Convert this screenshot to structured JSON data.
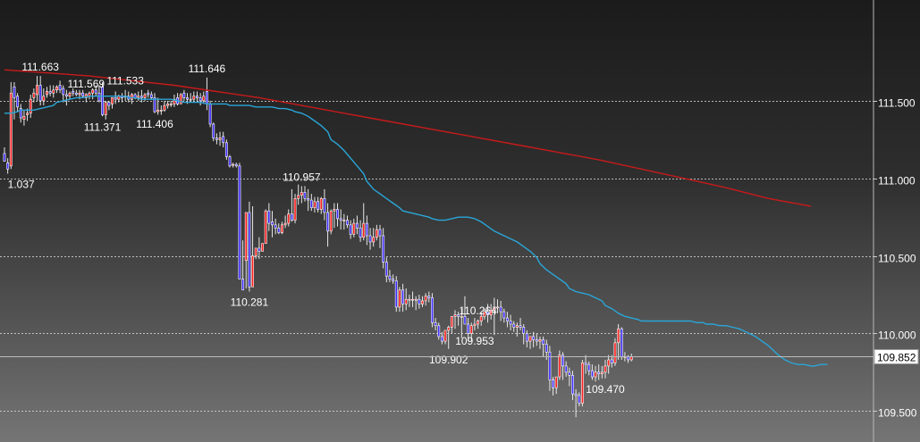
{
  "colors": {
    "up": "#ff1f1f",
    "down": "#3c2bff",
    "ma_short": "#2aa6d8",
    "ma_long": "#c81a1a",
    "grid": "#dddddd"
  },
  "chart_data": {
    "type": "candlestick",
    "ylim": [
      109.3,
      112.15
    ],
    "y_ticks": [
      {
        "value": 111.5,
        "label": "111.500"
      },
      {
        "value": 111.0,
        "label": "111.000"
      },
      {
        "value": 110.5,
        "label": "110.500"
      },
      {
        "value": 110.0,
        "label": "110.000"
      },
      {
        "value": 109.5,
        "label": "109.500"
      }
    ],
    "current_price": {
      "value": 109.852,
      "label": "109.852"
    },
    "x": [
      0,
      1,
      2,
      3,
      4,
      5,
      6,
      7,
      8,
      9,
      10,
      11,
      12,
      13,
      14,
      15,
      16,
      17,
      18,
      19,
      20,
      21,
      22,
      23,
      24,
      25,
      26,
      27,
      28,
      29,
      30,
      31,
      32,
      33,
      34,
      35,
      36,
      37,
      38,
      39,
      40,
      41,
      42,
      43,
      44,
      45,
      46,
      47,
      48,
      49,
      50,
      51,
      52,
      53,
      54,
      55,
      56,
      57,
      58,
      59,
      60,
      61,
      62,
      63,
      64,
      65,
      66,
      67,
      68,
      69,
      70,
      71,
      72,
      73,
      74,
      75,
      76,
      77,
      78,
      79,
      80,
      81,
      82,
      83,
      84,
      85,
      86,
      87,
      88,
      89,
      90,
      91,
      92,
      93,
      94,
      95,
      96,
      97,
      98,
      99,
      100,
      101,
      102,
      103,
      104,
      105,
      106,
      107,
      108,
      109,
      110,
      111,
      112,
      113,
      114,
      115,
      116,
      117,
      118,
      119,
      120,
      121,
      122,
      123,
      124,
      125,
      126,
      127,
      128,
      129,
      130,
      131,
      132,
      133,
      134,
      135,
      136,
      137,
      138,
      139,
      140,
      141,
      142,
      143,
      144,
      145,
      146,
      147,
      148,
      149,
      150,
      151,
      152,
      153,
      154,
      155,
      156,
      157,
      158,
      159,
      160,
      161,
      162,
      163,
      164,
      165,
      166,
      167,
      168,
      169,
      170,
      171,
      172,
      173,
      174,
      175,
      176,
      177,
      178,
      179,
      180,
      181,
      182,
      183,
      184,
      185,
      186,
      187,
      188,
      189,
      190,
      191,
      192,
      193,
      194,
      195,
      196,
      197,
      198,
      199,
      200,
      201,
      202,
      203,
      204,
      205,
      206,
      207,
      208,
      209,
      210,
      211,
      212,
      213,
      214,
      215,
      216,
      217,
      218,
      219,
      220,
      221,
      222,
      223,
      224,
      225,
      226,
      227,
      228,
      229,
      230,
      231,
      232,
      233,
      234,
      235,
      236,
      237,
      238,
      239,
      240,
      241,
      242,
      243,
      244,
      245,
      246,
      247,
      248,
      249,
      250,
      251,
      252
    ],
    "open": [
      111.16,
      111.1,
      111.08,
      111.59,
      111.53,
      111.45,
      111.38,
      111.41,
      111.42,
      111.52,
      111.54,
      111.6,
      111.5,
      111.54,
      111.56,
      111.55,
      111.57,
      111.6,
      111.58,
      111.54,
      111.53,
      111.56,
      111.55,
      111.54,
      111.55,
      111.52,
      111.53,
      111.55,
      111.57,
      111.55,
      111.59,
      111.41,
      111.49,
      111.48,
      111.52,
      111.51,
      111.53,
      111.53,
      111.53,
      111.51,
      111.54,
      111.52,
      111.53,
      111.52,
      111.55,
      111.54,
      111.52,
      111.43,
      111.44,
      111.44,
      111.47,
      111.48,
      111.48,
      111.52,
      111.48,
      111.55,
      111.52,
      111.51,
      111.51,
      111.53,
      111.52,
      111.5,
      111.56,
      111.48,
      111.35,
      111.26,
      111.25,
      111.27,
      111.23,
      111.14,
      111.09,
      111.09,
      111.08,
      110.35,
      110.47,
      110.78,
      110.3,
      110.5,
      110.55,
      110.53,
      110.58,
      110.79,
      110.72,
      110.7,
      110.68,
      110.65,
      110.7,
      110.71,
      110.77,
      110.73,
      110.87,
      110.89,
      110.91,
      110.87,
      110.86,
      110.81,
      110.85,
      110.8,
      110.87,
      110.78,
      110.66,
      110.79,
      110.8,
      110.74,
      110.73,
      110.73,
      110.7,
      110.64,
      110.71,
      110.68,
      110.62,
      110.71,
      110.63,
      110.59,
      110.62,
      110.67,
      110.63,
      110.46,
      110.37,
      110.35,
      110.34,
      110.17,
      110.28,
      110.19,
      110.22,
      110.22,
      110.22,
      110.22,
      110.19,
      110.21,
      110.24,
      110.23,
      110.07,
      110.05,
      109.98,
      109.95,
      110.02,
      110.04,
      110.11,
      110.12,
      110.11,
      110.11,
      110.06,
      110.0,
      110.05,
      110.06,
      110.08,
      110.11,
      110.14,
      110.12,
      110.15,
      110.17,
      110.17,
      110.14,
      110.1,
      110.08,
      110.06,
      110.04,
      110.05,
      110.04,
      110.0,
      109.95,
      109.98,
      109.96,
      109.95,
      109.96,
      109.93,
      109.88,
      109.7,
      109.65,
      109.72,
      109.86,
      109.79,
      109.75,
      109.73,
      109.61,
      109.6,
      109.55,
      109.81,
      109.8,
      109.76,
      109.72,
      109.75,
      109.74,
      109.75,
      109.79,
      109.83,
      109.81,
      109.94,
      110.03,
      109.85,
      109.85,
      109.83
    ],
    "high": [
      111.2,
      111.13,
      111.62,
      111.62,
      111.55,
      111.48,
      111.44,
      111.45,
      111.54,
      111.58,
      111.66,
      111.66,
      111.58,
      111.59,
      111.6,
      111.6,
      111.6,
      111.63,
      111.6,
      111.57,
      111.56,
      111.58,
      111.57,
      111.57,
      111.57,
      111.55,
      111.56,
      111.58,
      111.6,
      111.6,
      111.62,
      111.5,
      111.5,
      111.52,
      111.56,
      111.54,
      111.55,
      111.57,
      111.56,
      111.55,
      111.55,
      111.56,
      111.57,
      111.55,
      111.57,
      111.56,
      111.55,
      111.52,
      111.47,
      111.5,
      111.5,
      111.5,
      111.54,
      111.55,
      111.55,
      111.57,
      111.55,
      111.55,
      111.56,
      111.56,
      111.55,
      111.56,
      111.65,
      111.5,
      111.36,
      111.29,
      111.3,
      111.3,
      111.25,
      111.15,
      111.1,
      111.1,
      111.1,
      110.6,
      110.5,
      110.85,
      110.82,
      110.55,
      110.62,
      110.58,
      110.8,
      110.84,
      110.79,
      110.74,
      110.71,
      110.72,
      110.76,
      110.8,
      110.93,
      110.9,
      110.96,
      110.95,
      110.95,
      110.93,
      110.9,
      110.88,
      110.88,
      110.88,
      110.93,
      110.84,
      110.8,
      110.84,
      110.84,
      110.8,
      110.77,
      110.76,
      110.73,
      110.74,
      110.76,
      110.73,
      110.84,
      110.76,
      110.68,
      110.68,
      110.7,
      110.7,
      110.68,
      110.49,
      110.41,
      110.38,
      110.37,
      110.3,
      110.32,
      110.29,
      110.25,
      110.27,
      110.24,
      110.25,
      110.24,
      110.26,
      110.27,
      110.26,
      110.1,
      110.07,
      110.01,
      110.02,
      110.05,
      110.1,
      110.15,
      110.14,
      110.16,
      110.24,
      110.1,
      110.07,
      110.1,
      110.09,
      110.14,
      110.16,
      110.19,
      110.19,
      110.23,
      110.22,
      110.21,
      110.16,
      110.14,
      110.12,
      110.08,
      110.07,
      110.1,
      110.06,
      110.02,
      109.98,
      110.01,
      110.0,
      109.98,
      109.98,
      109.96,
      109.92,
      109.72,
      109.72,
      109.89,
      109.88,
      109.82,
      109.78,
      109.76,
      109.64,
      109.62,
      109.83,
      109.86,
      109.82,
      109.8,
      109.79,
      109.8,
      109.79,
      109.83,
      109.86,
      109.86,
      109.97,
      110.06,
      110.04,
      109.88,
      109.86,
      109.87
    ],
    "low": [
      111.11,
      111.03,
      111.06,
      111.38,
      111.43,
      111.36,
      111.34,
      111.37,
      111.39,
      111.49,
      111.5,
      111.47,
      111.47,
      111.52,
      111.53,
      111.52,
      111.55,
      111.55,
      111.49,
      111.47,
      111.51,
      111.53,
      111.53,
      111.51,
      111.52,
      111.49,
      111.51,
      111.51,
      111.53,
      111.49,
      111.4,
      111.38,
      111.44,
      111.45,
      111.48,
      111.49,
      111.49,
      111.5,
      111.49,
      111.48,
      111.51,
      111.5,
      111.49,
      111.5,
      111.52,
      111.51,
      111.42,
      111.41,
      111.41,
      111.43,
      111.45,
      111.46,
      111.46,
      111.47,
      111.48,
      111.5,
      111.48,
      111.49,
      111.49,
      111.49,
      111.47,
      111.48,
      111.44,
      111.33,
      111.24,
      111.22,
      111.21,
      111.2,
      111.12,
      111.07,
      111.07,
      111.07,
      110.71,
      110.28,
      110.29,
      110.27,
      110.42,
      110.48,
      110.48,
      110.55,
      110.6,
      110.66,
      110.62,
      110.64,
      110.64,
      110.64,
      110.68,
      110.69,
      110.72,
      110.71,
      110.83,
      110.84,
      110.85,
      110.79,
      110.79,
      110.78,
      110.78,
      110.77,
      110.73,
      110.56,
      110.64,
      110.68,
      110.69,
      110.67,
      110.67,
      110.68,
      110.61,
      110.62,
      110.64,
      110.59,
      110.6,
      110.57,
      110.54,
      110.56,
      110.6,
      110.55,
      110.42,
      110.33,
      110.33,
      110.32,
      110.14,
      110.14,
      110.14,
      110.15,
      110.17,
      110.17,
      110.15,
      110.16,
      110.17,
      110.18,
      110.2,
      110.04,
      110.02,
      109.96,
      109.93,
      109.93,
      109.9,
      110.0,
      110.03,
      110.05,
      109.97,
      110.06,
      109.95,
      109.95,
      110.02,
      110.03,
      110.05,
      110.09,
      110.07,
      110.09,
      109.99,
      110.13,
      110.08,
      110.07,
      110.04,
      110.02,
      110.01,
      109.98,
      110.02,
      109.93,
      109.91,
      109.9,
      109.91,
      109.92,
      109.9,
      109.85,
      109.83,
      109.63,
      109.6,
      109.61,
      109.7,
      109.7,
      109.72,
      109.66,
      109.57,
      109.46,
      109.53,
      109.53,
      109.74,
      109.73,
      109.7,
      109.69,
      109.7,
      109.71,
      109.71,
      109.74,
      109.78,
      109.79,
      109.83,
      109.83,
      109.82,
      109.81,
      109.82
    ],
    "close": [
      111.11,
      111.06,
      111.55,
      111.52,
      111.46,
      111.39,
      111.4,
      111.42,
      111.51,
      111.55,
      111.6,
      111.5,
      111.53,
      111.56,
      111.55,
      111.57,
      111.59,
      111.57,
      111.54,
      111.53,
      111.55,
      111.55,
      111.54,
      111.55,
      111.53,
      111.54,
      111.55,
      111.57,
      111.55,
      111.5,
      111.41,
      111.49,
      111.47,
      111.52,
      111.51,
      111.53,
      111.52,
      111.53,
      111.51,
      111.54,
      111.52,
      111.53,
      111.52,
      111.54,
      111.54,
      111.52,
      111.43,
      111.44,
      111.44,
      111.47,
      111.48,
      111.48,
      111.51,
      111.48,
      111.54,
      111.52,
      111.51,
      111.51,
      111.53,
      111.52,
      111.5,
      111.53,
      111.48,
      111.35,
      111.26,
      111.25,
      111.26,
      111.23,
      111.14,
      111.08,
      111.09,
      111.08,
      110.35,
      110.28,
      110.78,
      110.3,
      110.5,
      110.55,
      110.53,
      110.58,
      110.79,
      110.71,
      110.7,
      110.68,
      110.65,
      110.7,
      110.71,
      110.77,
      110.73,
      110.87,
      110.89,
      110.91,
      110.87,
      110.86,
      110.81,
      110.85,
      110.8,
      110.87,
      110.78,
      110.66,
      110.79,
      110.8,
      110.74,
      110.73,
      110.73,
      110.7,
      110.64,
      110.71,
      110.68,
      110.62,
      110.71,
      110.63,
      110.59,
      110.62,
      110.67,
      110.63,
      110.46,
      110.37,
      110.35,
      110.34,
      110.17,
      110.28,
      110.19,
      110.22,
      110.22,
      110.22,
      110.22,
      110.19,
      110.21,
      110.24,
      110.23,
      110.07,
      110.05,
      109.98,
      109.95,
      110.02,
      110.04,
      110.11,
      110.12,
      110.11,
      110.11,
      110.06,
      110.0,
      110.05,
      110.06,
      110.08,
      110.11,
      110.14,
      110.12,
      110.15,
      110.17,
      110.17,
      110.14,
      110.1,
      110.08,
      110.06,
      110.04,
      110.05,
      110.04,
      110.0,
      109.95,
      109.98,
      109.96,
      109.95,
      109.96,
      109.93,
      109.88,
      109.7,
      109.65,
      109.72,
      109.86,
      109.79,
      109.75,
      109.73,
      109.61,
      109.6,
      109.55,
      109.81,
      109.8,
      109.76,
      109.72,
      109.75,
      109.74,
      109.75,
      109.79,
      109.83,
      109.81,
      109.94,
      110.03,
      109.85,
      109.85,
      109.83,
      109.85
    ],
    "ma_short_values": [
      111.42,
      111.42,
      111.43,
      111.44,
      111.44,
      111.44,
      111.45,
      111.46,
      111.47,
      111.49,
      111.5,
      111.51,
      111.52,
      111.52,
      111.53,
      111.53,
      111.53,
      111.53,
      111.53,
      111.53,
      111.53,
      111.52,
      111.52,
      111.51,
      111.51,
      111.51,
      111.51,
      111.51,
      111.51,
      111.5,
      111.49,
      111.49,
      111.49,
      111.49,
      111.48,
      111.48,
      111.48,
      111.48,
      111.47,
      111.47,
      111.47,
      111.47,
      111.46,
      111.46,
      111.46,
      111.46,
      111.45,
      111.45,
      111.44,
      111.43,
      111.42,
      111.4,
      111.37,
      111.34,
      111.3,
      111.25,
      111.22,
      111.18,
      111.13,
      111.08,
      111.03,
      110.98,
      110.93,
      110.9,
      110.87,
      110.84,
      110.81,
      110.79,
      110.78,
      110.77,
      110.76,
      110.75,
      110.74,
      110.73,
      110.73,
      110.74,
      110.75,
      110.75,
      110.75,
      110.74,
      110.72,
      110.69,
      110.66,
      110.64,
      110.63,
      110.61,
      110.59,
      110.56,
      110.53,
      110.49,
      110.45,
      110.41,
      110.38,
      110.35,
      110.32,
      110.29,
      110.27,
      110.26,
      110.25,
      110.23,
      110.21,
      110.18,
      110.16,
      110.13,
      110.11,
      110.1,
      110.09,
      110.08,
      110.08,
      110.08,
      110.08,
      110.08,
      110.08,
      110.08,
      110.08,
      110.08,
      110.07,
      110.07,
      110.06,
      110.06,
      110.05,
      110.05,
      110.04,
      110.03,
      110.02,
      110.0,
      109.98,
      109.95,
      109.92,
      109.88,
      109.86,
      109.83,
      109.81,
      109.8,
      109.8,
      109.79,
      109.79,
      109.8,
      109.8
    ],
    "ma_short_start": 0,
    "ma_long_values": [
      111.7,
      111.68,
      111.66,
      111.63,
      111.6,
      111.56,
      111.52,
      111.47,
      111.42,
      111.37,
      111.32,
      111.27,
      111.22,
      111.17,
      111.12,
      111.06,
      111.0,
      110.94,
      110.87,
      110.82
    ],
    "ma_long_step": 13,
    "annotations": [
      {
        "text": "111.663",
        "index": 11,
        "pos": "above"
      },
      {
        "text": "111.569",
        "index": 25,
        "pos": "above"
      },
      {
        "text": "111.533",
        "index": 37,
        "pos": "above"
      },
      {
        "text": "111.646",
        "index": 62,
        "pos": "above"
      },
      {
        "text": "111.371",
        "index": 30,
        "pos": "below"
      },
      {
        "text": "111.406",
        "index": 46,
        "pos": "below"
      },
      {
        "text": "1.037",
        "index": 1,
        "pos": "below"
      },
      {
        "text": "110.957",
        "index": 91,
        "pos": "above"
      },
      {
        "text": "110.281",
        "index": 75,
        "pos": "below"
      },
      {
        "text": "110.264",
        "index": 145,
        "pos": "above"
      },
      {
        "text": "109.902",
        "index": 136,
        "pos": "below"
      },
      {
        "text": "109.953",
        "index": 144,
        "pos": "below"
      },
      {
        "text": "109.470",
        "index": 184,
        "pos": "below"
      }
    ]
  }
}
